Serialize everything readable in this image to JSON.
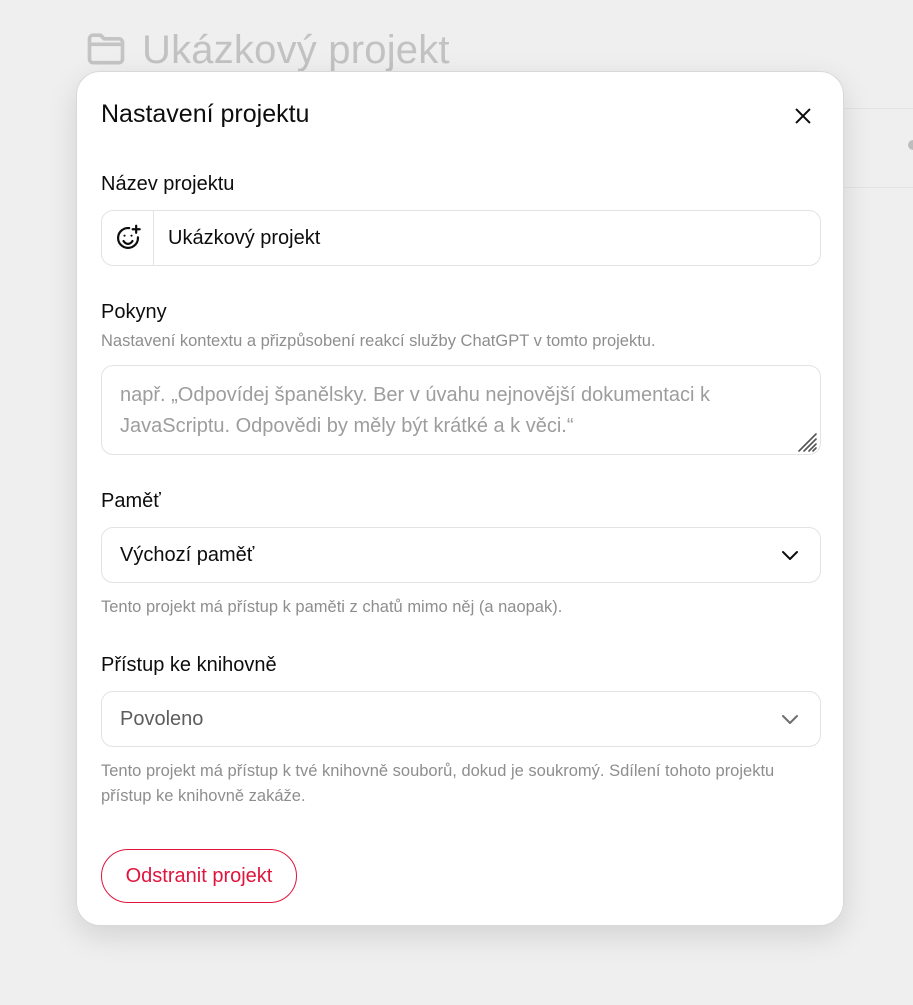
{
  "background": {
    "project_title": "Ukázkový projekt",
    "folder_icon": "folder-icon"
  },
  "modal": {
    "title": "Nastavení projektu",
    "close_icon": "close-icon",
    "name": {
      "label": "Název projektu",
      "emoji_icon": "emoji-add-icon",
      "value": "Ukázkový projekt"
    },
    "instructions": {
      "label": "Pokyny",
      "description": "Nastavení kontextu a přizpůsobení reakcí služby ChatGPT v tomto projektu.",
      "placeholder": "např. „Odpovídej španělsky. Ber v úvahu nejnovější dokumentaci k JavaScriptu. Odpovědi by měly být krátké a k věci.“",
      "value": ""
    },
    "memory": {
      "label": "Paměť",
      "selected": "Výchozí paměť",
      "help": "Tento projekt má přístup k paměti z chatů mimo něj (a naopak).",
      "chevron_icon": "chevron-down-icon"
    },
    "library": {
      "label": "Přístup ke knihovně",
      "selected": "Povoleno",
      "help": "Tento projekt má přístup k tvé knihovně souborů, dokud je soukromý. Sdílení tohoto projektu přístup ke knihovně zakáže.",
      "chevron_icon": "chevron-down-icon"
    },
    "delete_label": "Odstranit projekt",
    "colors": {
      "danger": "#e0143c",
      "border": "#e3e3e3",
      "muted_text": "#8e8e8e"
    }
  }
}
